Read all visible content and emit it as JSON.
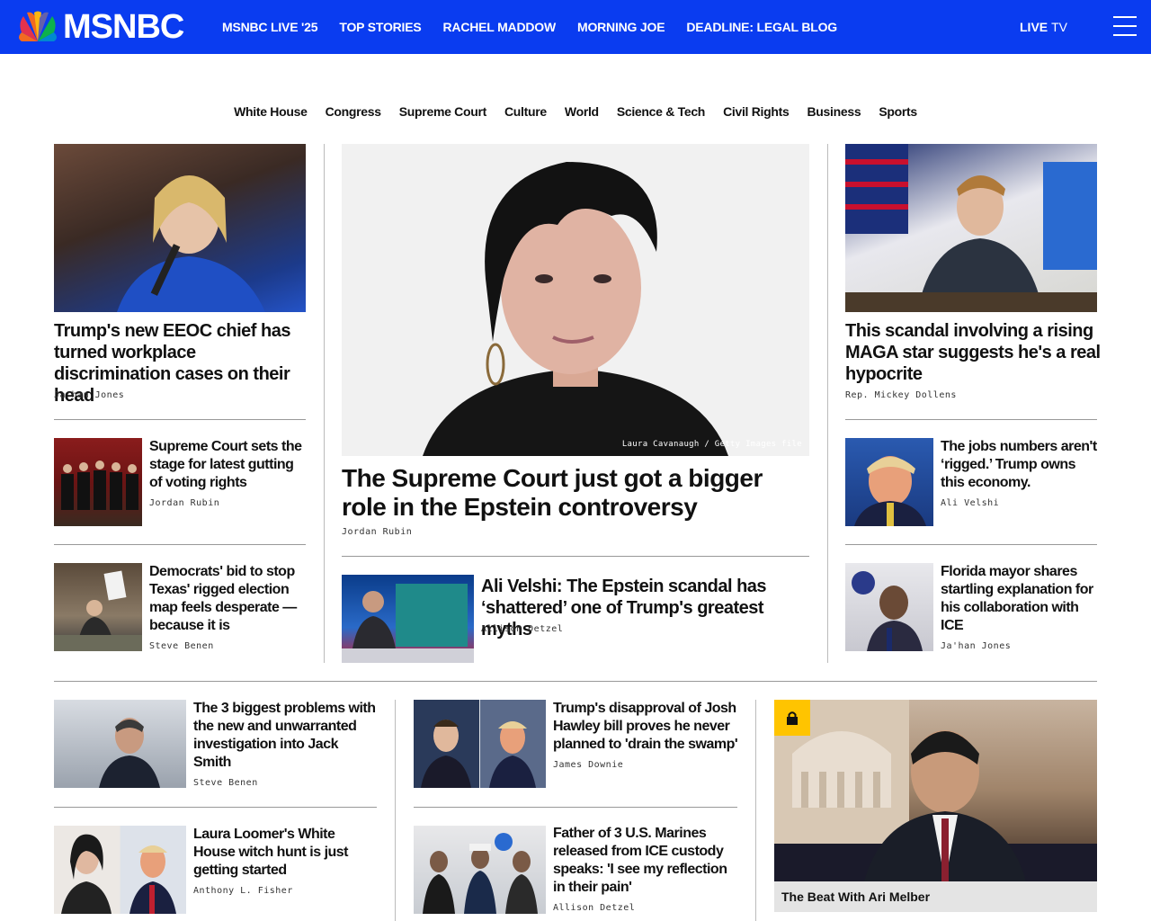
{
  "brand": {
    "name": "MSNBC",
    "bar_color": "#0a3cf0"
  },
  "nav": {
    "items": [
      "MSNBC LIVE '25",
      "TOP STORIES",
      "RACHEL MADDOW",
      "MORNING JOE",
      "DEADLINE: LEGAL BLOG"
    ],
    "live": "LIVE",
    "tv": "TV"
  },
  "subnav": [
    "White House",
    "Congress",
    "Supreme Court",
    "Culture",
    "World",
    "Science & Tech",
    "Civil Rights",
    "Business",
    "Sports"
  ],
  "left": {
    "top": {
      "headline": "Trump's new EEOC chief has turned workplace discrimination cases on their head",
      "byline": "Ja'han Jones"
    },
    "items": [
      {
        "headline": "Supreme Court sets the stage for latest gutting of voting rights",
        "byline": "Jordan Rubin"
      },
      {
        "headline": "Democrats' bid to stop Texas' rigged election map feels desperate — because it is",
        "byline": "Steve Benen"
      }
    ]
  },
  "center": {
    "lead": {
      "headline": "The Supreme Court just got a bigger role in the Epstein controversy",
      "byline": "Jordan Rubin",
      "credit": "Laura Cavanaugh / Getty Images file"
    },
    "item": {
      "headline": "Ali Velshi: The Epstein scandal has ‘shattered’ one of Trump's greatest myths",
      "byline": "Allison Detzel"
    }
  },
  "right": {
    "top": {
      "headline": "This scandal involving a rising MAGA star suggests he's a real hypocrite",
      "byline": "Rep. Mickey Dollens"
    },
    "items": [
      {
        "headline": "The jobs numbers aren't ‘rigged.’ Trump owns this economy.",
        "byline": "Ali Velshi"
      },
      {
        "headline": "Florida mayor shares startling explanation for his collaboration with ICE",
        "byline": "Ja'han Jones"
      }
    ]
  },
  "bottom": {
    "col1": [
      {
        "headline": "The 3 biggest problems with the new and unwarranted investigation into Jack Smith",
        "byline": "Steve Benen"
      },
      {
        "headline": "Laura Loomer's White House witch hunt is just getting started",
        "byline": "Anthony L. Fisher"
      }
    ],
    "col2": [
      {
        "headline": "Trump's disapproval of Josh Hawley bill proves he never planned to 'drain the swamp'",
        "byline": "James Downie"
      },
      {
        "headline": "Father of 3 U.S. Marines released from ICE custody speaks: 'I see my reflection in their pain'",
        "byline": "Allison Detzel"
      }
    ],
    "video": {
      "caption": "The Beat With Ari Melber",
      "badge_icon": "lock-icon"
    }
  }
}
